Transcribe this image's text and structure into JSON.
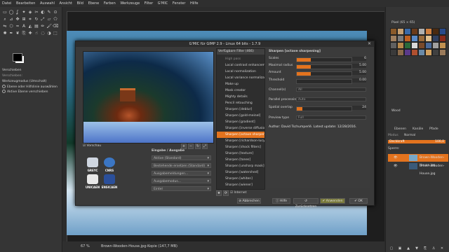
{
  "menubar": {
    "items": [
      "Datei",
      "Bearbeiten",
      "Auswahl",
      "Ansicht",
      "Bild",
      "Ebene",
      "Farben",
      "Werkzeuge",
      "Filter",
      "G'MIC",
      "Fenster",
      "Hilfe"
    ]
  },
  "toolbox": {
    "fg_color": "#000000",
    "bg_color": "#ffffff",
    "tool_panel_title": "Verschieben",
    "tool_option_label": "Verschieben:",
    "tool_options_title": "Werkzeugmodus (Umschalt)",
    "option_1": "Ebene oder Hilfslinie auswählen",
    "option_2": "Aktive Ebene verschieben"
  },
  "statusbar": {
    "zoom": "67 %",
    "info": "Brown-Wooden-House.jpg-Kopie (147,7 MB)"
  },
  "dialog": {
    "title": "G'MIC für GIMP 2.9 - Linux 64 bits - 1.7.9",
    "close_glyph": "✕",
    "preview_label": "Vorschau",
    "io_title": "Eingabe / Ausgabe",
    "io_options": [
      "Aktive (Standard)",
      "Bestehende ersetzen (Standard)",
      "Ausgabemeldungen...",
      "Ausgabemodus...",
      "Eintel"
    ],
    "logos": {
      "greyc": "GREYC",
      "cnrs": "CNRS",
      "unicaen": "UNICAEN",
      "ensicaen": "ENSICAEN"
    },
    "filters_header": "Verfügbare Filter (466)",
    "filters": [
      {
        "label": "High pass",
        "dim": true
      },
      {
        "label": "Local contrast enhancement",
        "dim": false
      },
      {
        "label": "Local normalization",
        "dim": false
      },
      {
        "label": "Local variance normalization",
        "dim": false
      },
      {
        "label": "Make up",
        "dim": false
      },
      {
        "label": "Mask creator",
        "dim": false
      },
      {
        "label": "Mighty details",
        "dim": false
      },
      {
        "label": "Pencil retouching",
        "dim": false
      },
      {
        "label": "Sharpen [deblur]",
        "dim": false
      },
      {
        "label": "Sharpen [gold-meinel]",
        "dim": false
      },
      {
        "label": "Sharpen [gradient]",
        "dim": false
      },
      {
        "label": "Sharpen [inverse diffusion]",
        "dim": false
      },
      {
        "label": "Sharpen [octave sharpening]",
        "dim": false
      },
      {
        "label": "Sharpen [richardson-lucy]",
        "dim": false
      },
      {
        "label": "Sharpen [shock filters]",
        "dim": false
      },
      {
        "label": "Sharpen [texture]",
        "dim": false
      },
      {
        "label": "Sharpen [tones]",
        "dim": false
      },
      {
        "label": "Sharpen [unsharp mask]",
        "dim": false
      },
      {
        "label": "Sharpen [watershed]",
        "dim": false
      },
      {
        "label": "Sharpen [whiten]",
        "dim": false
      },
      {
        "label": "Sharpen [wiener]",
        "dim": false
      }
    ],
    "selected_filter": 12,
    "internet_label": "Internet",
    "params_title": "Sharpen [octave sharpening]",
    "params": {
      "scales": {
        "label": "Scales",
        "value": "6",
        "fraction": 0.25
      },
      "max_radius": {
        "label": "Maximal radius",
        "value": "5.00",
        "fraction": 0.25
      },
      "amount": {
        "label": "Amount",
        "value": "5.00",
        "fraction": 0.25
      },
      "threshold": {
        "label": "Threshold",
        "value": "0.00",
        "fraction": 0.0
      },
      "channels": {
        "label": "Channel(s)",
        "value": "All"
      },
      "parallel": {
        "label": "Parallel processing",
        "value": "Auto"
      },
      "spatial_overlap": {
        "label": "Spatial overlap",
        "value": "24",
        "fraction": 0.1
      },
      "preview_type": {
        "label": "Preview type",
        "value": "Full"
      }
    },
    "author_note": "Author: David Tschumperlé.      Latest update: 12/28/2016.",
    "buttons": {
      "cancel": "Abbrechen",
      "help": "Hilfe",
      "reset": "Zurücksetzen",
      "apply": "Anwenden",
      "ok": "OK"
    }
  },
  "right_dock": {
    "brush_label": "Pixel (65 × 65)",
    "pattern_name": "Wood",
    "tabs": [
      "Ebenen",
      "Kanäle",
      "Pfade"
    ],
    "mode_label": "Modus",
    "mode_value": "Normal",
    "opacity_label": "Deckkraft",
    "opacity_value": "100,0",
    "lock_label": "Sperre:",
    "layers": [
      {
        "name": "Brown-Wooden-House.jpg",
        "selected": true
      },
      {
        "name": "Brown-Wooden-House.jpg",
        "selected": false
      }
    ]
  }
}
